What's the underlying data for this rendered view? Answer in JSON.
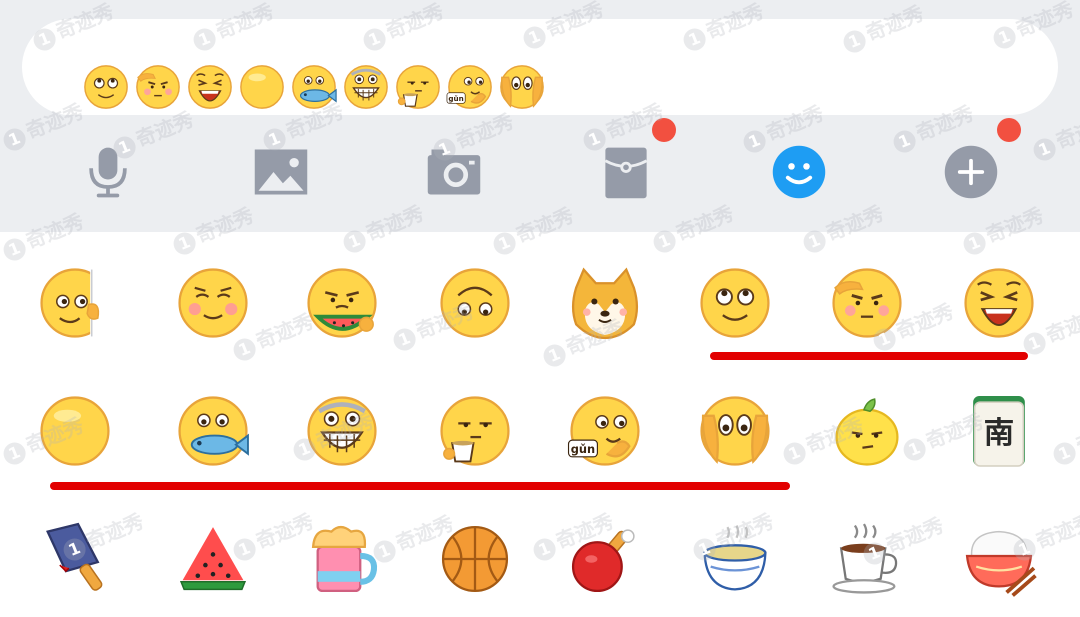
{
  "watermark": "奇迹秀",
  "recent_emojis": [
    "smile-eyes-up",
    "salute",
    "laughing-tears",
    "blank-face",
    "eating-fish",
    "grin-teeth",
    "sipping-tea",
    "gun-roll",
    "peeking-hands"
  ],
  "toolbar": [
    {
      "icon": "microphone-icon",
      "badge": false
    },
    {
      "icon": "image-icon",
      "badge": false
    },
    {
      "icon": "camera-icon",
      "badge": false
    },
    {
      "icon": "red-packet-icon",
      "badge": true
    },
    {
      "icon": "emoji-icon",
      "badge": false,
      "active": true
    },
    {
      "icon": "plus-icon",
      "badge": true
    }
  ],
  "grid_rows": [
    [
      "peeking-wall",
      "shy-blush",
      "eating-watermelon",
      "upside-down",
      "doge",
      "smile-eyes-up",
      "salute",
      "laughing-tears"
    ],
    [
      "blank-face",
      "eating-fish",
      "grin-teeth",
      "sipping-tea",
      "gun-roll",
      "peeking-hands",
      "lemon",
      "mahjong-nan"
    ],
    [
      "cleaver",
      "watermelon-slice",
      "beer-mug",
      "basketball",
      "ping-pong",
      "tea-bowl",
      "coffee-cup",
      "rice-bowl"
    ]
  ],
  "mahjong_text": "南",
  "gun_text": "gǔn",
  "colors": {
    "accent": "#1e9df3",
    "badge": "#f25040",
    "underline": "#e20000",
    "icon_gray": "#959ba8",
    "face": "#ffd54a"
  }
}
